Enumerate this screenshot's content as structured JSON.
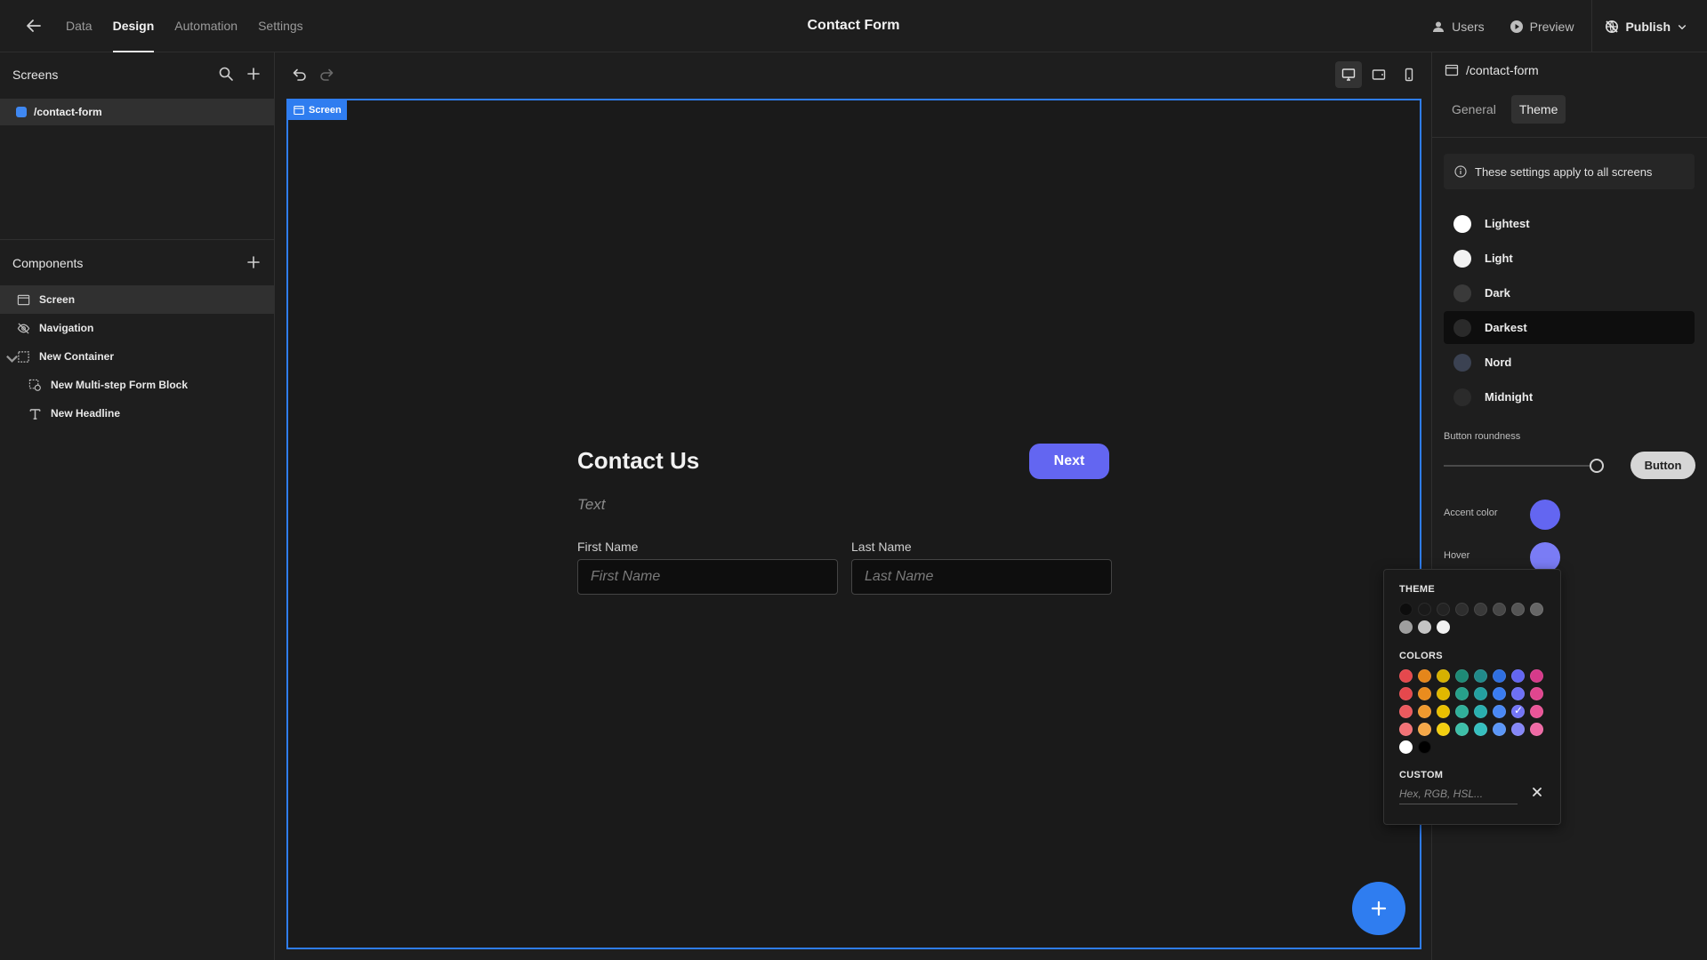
{
  "topbar": {
    "tabs": [
      {
        "label": "Data"
      },
      {
        "label": "Design"
      },
      {
        "label": "Automation"
      },
      {
        "label": "Settings"
      }
    ],
    "active_tab": "Design",
    "app_title": "Contact Form",
    "users_label": "Users",
    "preview_label": "Preview",
    "publish_label": "Publish"
  },
  "left": {
    "screens_title": "Screens",
    "screen_item": "/contact-form",
    "components_title": "Components",
    "components": [
      {
        "label": "Screen",
        "icon": "screen-icon"
      },
      {
        "label": "Navigation",
        "icon": "eye-off-icon"
      },
      {
        "label": "New Container",
        "icon": "container-icon"
      },
      {
        "label": "New Multi-step Form Block",
        "icon": "form-block-icon"
      },
      {
        "label": "New Headline",
        "icon": "text-icon"
      }
    ],
    "selected_component": "Screen"
  },
  "canvas": {
    "screen_tag": "Screen",
    "headline": "Contact Us",
    "next_label": "Next",
    "text_placeholder": "Text",
    "first_name_label": "First Name",
    "first_name_placeholder": "First Name",
    "last_name_label": "Last Name",
    "last_name_placeholder": "Last Name"
  },
  "right": {
    "route": "/contact-form",
    "tabs": [
      {
        "label": "General"
      },
      {
        "label": "Theme"
      }
    ],
    "active_tab": "Theme",
    "info_text": "These settings apply to all screens",
    "themes": [
      {
        "label": "Lightest",
        "color": "#ffffff"
      },
      {
        "label": "Light",
        "color": "#f2f2f2"
      },
      {
        "label": "Dark",
        "color": "#3a3a3a"
      },
      {
        "label": "Darkest",
        "color": "#2a2a2a"
      },
      {
        "label": "Nord",
        "color": "#3b4252"
      },
      {
        "label": "Midnight",
        "color": "#2b2b2b"
      }
    ],
    "selected_theme": "Darkest",
    "button_roundness_label": "Button roundness",
    "button_roundness_value": 1,
    "button_preview_label": "Button",
    "accent_label": "Accent color",
    "accent_color": "#6366f1",
    "hover_label": "Hover",
    "hover_color": "#7a7cf5"
  },
  "picker": {
    "theme_title": "THEME",
    "theme_colors": [
      "#0d0d0d",
      "#1a1a1a",
      "#232323",
      "#2e2e2e",
      "#393939",
      "#474747",
      "#555555",
      "#666666",
      "#9e9e9e",
      "#c4c4c4",
      "#f2f2f2"
    ],
    "colors_title": "COLORS",
    "color_grid": [
      [
        "#e5484d",
        "#e5861a",
        "#d6b100",
        "#1e8a76",
        "#218a8a",
        "#2f6fe0",
        "#6366f1",
        "#d63a8a"
      ],
      [
        "#e5484d",
        "#ea8c1e",
        "#e0b800",
        "#27a08a",
        "#24a0a0",
        "#3a7cf0",
        "#6e70f3",
        "#e0468f"
      ],
      [
        "#ec5a5e",
        "#f09a2e",
        "#eac000",
        "#30b09a",
        "#2ab0b0",
        "#4a88f5",
        "#7375f5",
        "#ea5598"
      ],
      [
        "#f27276",
        "#f5a848",
        "#f3cf10",
        "#3dbfa8",
        "#36bfbf",
        "#5b96f7",
        "#8587f7",
        "#ef6aa5"
      ],
      [
        "#ffffff",
        "#000000"
      ]
    ],
    "checked_color": "#7375f5",
    "custom_title": "CUSTOM",
    "custom_placeholder": "Hex, RGB, HSL..."
  },
  "colors": {
    "accent_blue": "#2f7df0",
    "background": "#1e1e1e"
  }
}
